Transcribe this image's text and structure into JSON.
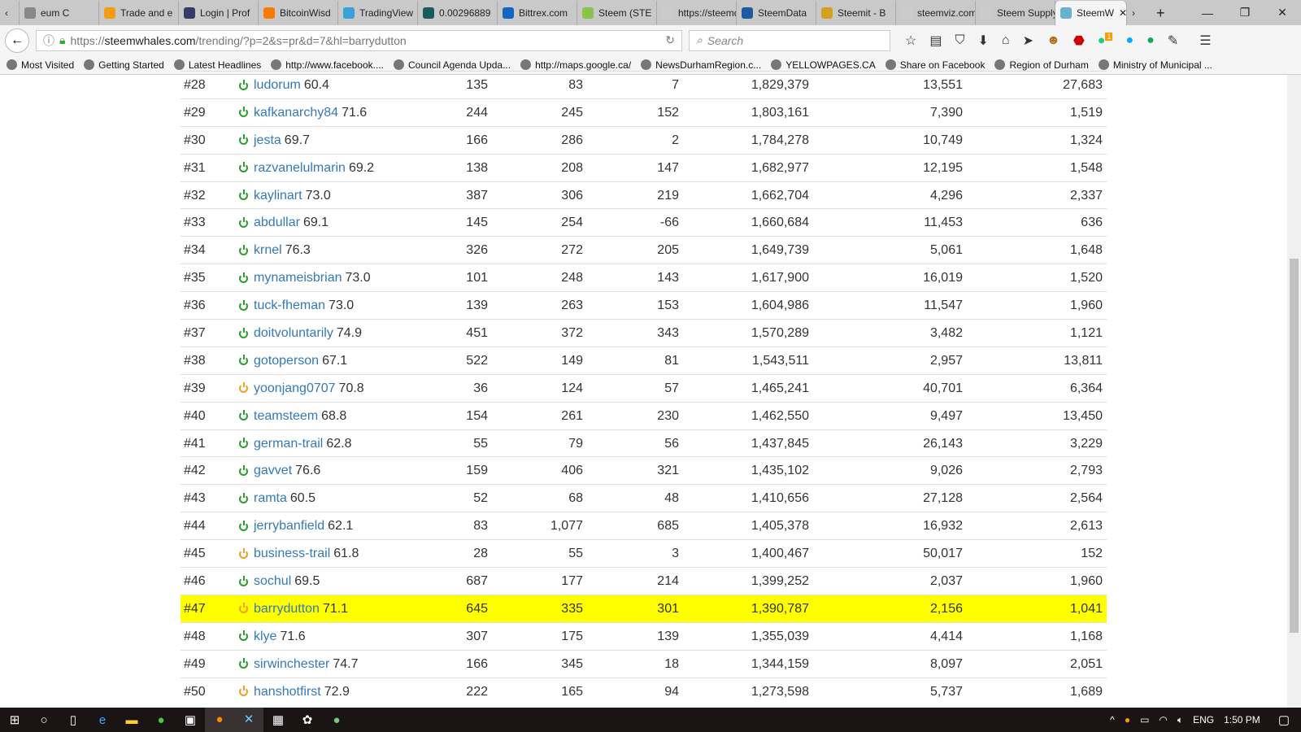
{
  "browser": {
    "tabs": [
      {
        "label": "eum C",
        "color": "#888"
      },
      {
        "label": "Trade and e",
        "color": "#f39c12"
      },
      {
        "label": "Login | Prof",
        "color": "#3a3a6a"
      },
      {
        "label": "BitcoinWisd",
        "color": "#f57c00"
      },
      {
        "label": "TradingView",
        "color": "#3aa0d8"
      },
      {
        "label": "0.00296889",
        "color": "#1a5a5a"
      },
      {
        "label": "Bittrex.com",
        "color": "#1565c0"
      },
      {
        "label": "Steem (STE",
        "color": "#8bc34a"
      },
      {
        "label": "https://steemd.",
        "color": "#ccc"
      },
      {
        "label": "SteemData",
        "color": "#1e5aa0"
      },
      {
        "label": "Steemit - B",
        "color": "#d4a020"
      },
      {
        "label": "steemviz.com :",
        "color": "#ccc"
      },
      {
        "label": "Steem Supply -",
        "color": "#ccc"
      },
      {
        "label": "SteemW",
        "color": "#6ab0d0",
        "active": true
      }
    ],
    "url_prefix": "https://",
    "url_domain": "steemwhales.com",
    "url_path": "/trending/?p=2&s=pr&d=7&hl=barrydutton",
    "search_placeholder": "Search",
    "bookmarks": [
      "Most Visited",
      "Getting Started",
      "Latest Headlines",
      "http://www.facebook....",
      "Council Agenda Upda...",
      "http://maps.google.ca/",
      "NewsDurhamRegion.c...",
      "YELLOWPAGES.CA",
      "Share on Facebook",
      "Region of Durham",
      "Ministry of Municipal ..."
    ],
    "notification_badge": "1"
  },
  "table": {
    "rows": [
      [
        "#28",
        "ludorum",
        "60.4",
        "135",
        "83",
        "7",
        "1,829,379",
        "13,551",
        "27,683",
        "green"
      ],
      [
        "#29",
        "kafkanarchy84",
        "71.6",
        "244",
        "245",
        "152",
        "1,803,161",
        "7,390",
        "1,519",
        "green"
      ],
      [
        "#30",
        "jesta",
        "69.7",
        "166",
        "286",
        "2",
        "1,784,278",
        "10,749",
        "1,324",
        "green"
      ],
      [
        "#31",
        "razvanelulmarin",
        "69.2",
        "138",
        "208",
        "147",
        "1,682,977",
        "12,195",
        "1,548",
        "green"
      ],
      [
        "#32",
        "kaylinart",
        "73.0",
        "387",
        "306",
        "219",
        "1,662,704",
        "4,296",
        "2,337",
        "green"
      ],
      [
        "#33",
        "abdullar",
        "69.1",
        "145",
        "254",
        "-66",
        "1,660,684",
        "11,453",
        "636",
        "green"
      ],
      [
        "#34",
        "krnel",
        "76.3",
        "326",
        "272",
        "205",
        "1,649,739",
        "5,061",
        "1,648",
        "green"
      ],
      [
        "#35",
        "mynameisbrian",
        "73.0",
        "101",
        "248",
        "143",
        "1,617,900",
        "16,019",
        "1,520",
        "green"
      ],
      [
        "#36",
        "tuck-fheman",
        "73.0",
        "139",
        "263",
        "153",
        "1,604,986",
        "11,547",
        "1,960",
        "green"
      ],
      [
        "#37",
        "doitvoluntarily",
        "74.9",
        "451",
        "372",
        "343",
        "1,570,289",
        "3,482",
        "1,121",
        "green"
      ],
      [
        "#38",
        "gotoperson",
        "67.1",
        "522",
        "149",
        "81",
        "1,543,511",
        "2,957",
        "13,811",
        "green"
      ],
      [
        "#39",
        "yoonjang0707",
        "70.8",
        "36",
        "124",
        "57",
        "1,465,241",
        "40,701",
        "6,364",
        "orange"
      ],
      [
        "#40",
        "teamsteem",
        "68.8",
        "154",
        "261",
        "230",
        "1,462,550",
        "9,497",
        "13,450",
        "green"
      ],
      [
        "#41",
        "german-trail",
        "62.8",
        "55",
        "79",
        "56",
        "1,437,845",
        "26,143",
        "3,229",
        "green"
      ],
      [
        "#42",
        "gavvet",
        "76.6",
        "159",
        "406",
        "321",
        "1,435,102",
        "9,026",
        "2,793",
        "green"
      ],
      [
        "#43",
        "ramta",
        "60.5",
        "52",
        "68",
        "48",
        "1,410,656",
        "27,128",
        "2,564",
        "green"
      ],
      [
        "#44",
        "jerrybanfield",
        "62.1",
        "83",
        "1,077",
        "685",
        "1,405,378",
        "16,932",
        "2,613",
        "green"
      ],
      [
        "#45",
        "business-trail",
        "61.8",
        "28",
        "55",
        "3",
        "1,400,467",
        "50,017",
        "152",
        "orange"
      ],
      [
        "#46",
        "sochul",
        "69.5",
        "687",
        "177",
        "214",
        "1,399,252",
        "2,037",
        "1,960",
        "green"
      ],
      [
        "#47",
        "barrydutton",
        "71.1",
        "645",
        "335",
        "301",
        "1,390,787",
        "2,156",
        "1,041",
        "orange"
      ],
      [
        "#48",
        "klye",
        "71.6",
        "307",
        "175",
        "139",
        "1,355,039",
        "4,414",
        "1,168",
        "green"
      ],
      [
        "#49",
        "sirwinchester",
        "74.7",
        "166",
        "345",
        "18",
        "1,344,159",
        "8,097",
        "2,051",
        "green"
      ],
      [
        "#50",
        "hanshotfirst",
        "72.9",
        "222",
        "165",
        "94",
        "1,273,598",
        "5,737",
        "1,689",
        "orange"
      ]
    ],
    "highlighted": "barrydutton",
    "highlight_color": "#ffff00"
  },
  "taskbar": {
    "language": "ENG",
    "time": "1:50 PM"
  }
}
